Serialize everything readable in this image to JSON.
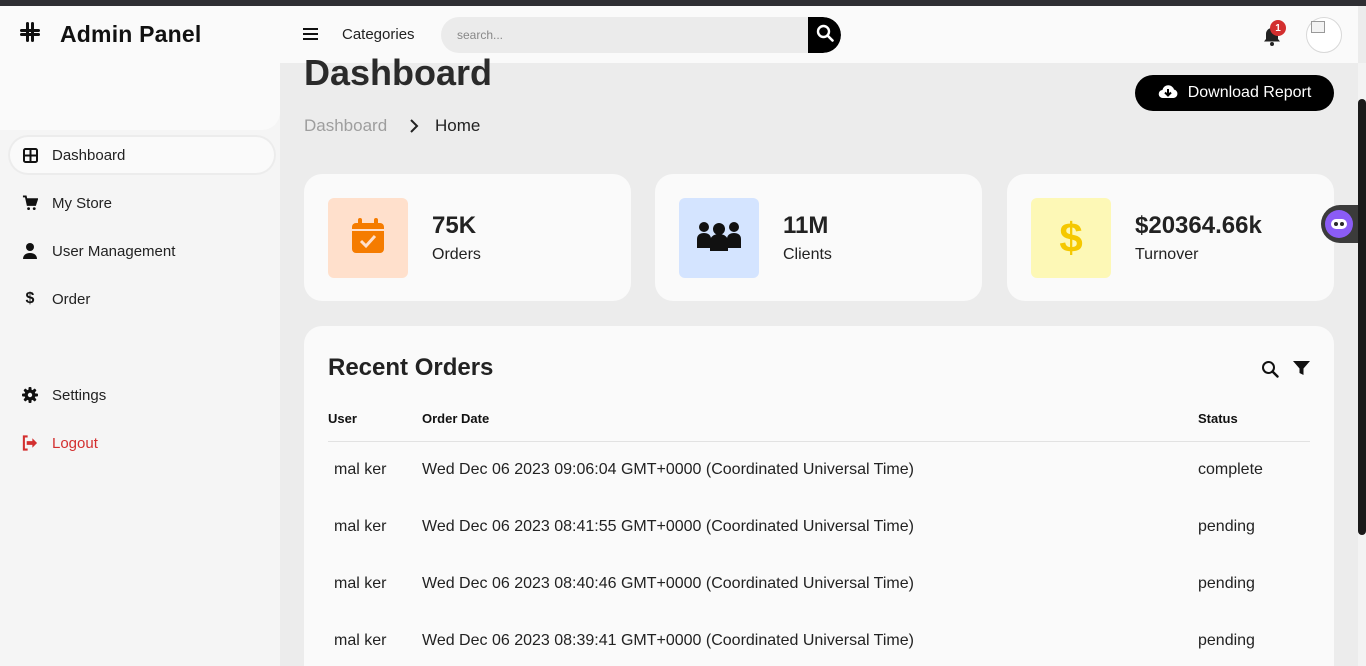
{
  "app": {
    "brand_title": "Admin Panel"
  },
  "header": {
    "categories_label": "Categories",
    "search_placeholder": "search...",
    "notification_count": "1"
  },
  "sidebar": {
    "items": [
      {
        "label": "Dashboard",
        "icon": "dashboard-grid-icon",
        "active": true
      },
      {
        "label": "My Store",
        "icon": "cart-icon"
      },
      {
        "label": "User Management",
        "icon": "user-icon"
      },
      {
        "label": "Order",
        "icon": "dollar-icon"
      },
      {
        "label": "Settings",
        "icon": "gear-icon"
      },
      {
        "label": "Logout",
        "icon": "logout-icon"
      }
    ]
  },
  "page": {
    "title": "Dashboard",
    "breadcrumb": [
      "Dashboard",
      "Home"
    ],
    "download_label": "Download Report"
  },
  "stats": [
    {
      "value": "75K",
      "label": "Orders",
      "icon": "calendar-check-icon",
      "icon_bg": "#ffe0cc",
      "icon_color": "#f57c00"
    },
    {
      "value": "11M",
      "label": "Clients",
      "icon": "users-group-icon",
      "icon_bg": "#d4e4ff",
      "icon_color": "#111111"
    },
    {
      "value": "$20364.66k",
      "label": "Turnover",
      "icon": "dollar-icon",
      "icon_bg": "#fdf8b6",
      "icon_color": "#f5c800"
    }
  ],
  "orders": {
    "title": "Recent Orders",
    "columns": [
      "User",
      "Order Date",
      "Status"
    ],
    "rows": [
      {
        "user": "mal ker",
        "date": "Wed Dec 06 2023 09:06:04 GMT+0000 (Coordinated Universal Time)",
        "status": "complete"
      },
      {
        "user": "mal ker",
        "date": "Wed Dec 06 2023 08:41:55 GMT+0000 (Coordinated Universal Time)",
        "status": "pending"
      },
      {
        "user": "mal ker",
        "date": "Wed Dec 06 2023 08:40:46 GMT+0000 (Coordinated Universal Time)",
        "status": "pending"
      },
      {
        "user": "mal ker",
        "date": "Wed Dec 06 2023 08:39:41 GMT+0000 (Coordinated Universal Time)",
        "status": "pending"
      }
    ]
  },
  "colors": {
    "accent": "#000000",
    "logout": "#d32f2f",
    "badge": "#d32f2f",
    "chat": "#8b5cf6"
  }
}
